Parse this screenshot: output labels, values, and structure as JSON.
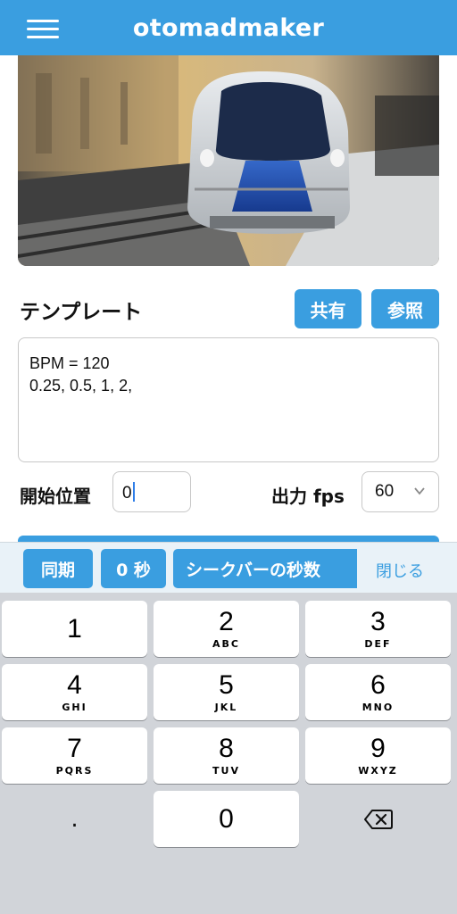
{
  "header": {
    "title": "otomadmaker"
  },
  "template_section": {
    "title": "テンプレート",
    "share_label": "共有",
    "reference_label": "参照",
    "text": "BPM = 120\n0.25, 0.5, 1, 2,"
  },
  "controls": {
    "start_position_label": "開始位置",
    "start_position_value": "0",
    "fps_label": "出力 fps",
    "fps_value": "60"
  },
  "accessory_bar": {
    "sync_label": "同期",
    "zero_sec_label": "0 秒",
    "seekbar_seconds_label": "シークバーの秒数",
    "close_label": "閉じる"
  },
  "keyboard": {
    "keys": [
      {
        "num": "1",
        "letters": ""
      },
      {
        "num": "2",
        "letters": "ABC"
      },
      {
        "num": "3",
        "letters": "DEF"
      },
      {
        "num": "4",
        "letters": "GHI"
      },
      {
        "num": "5",
        "letters": "JKL"
      },
      {
        "num": "6",
        "letters": "MNO"
      },
      {
        "num": "7",
        "letters": "PQRS"
      },
      {
        "num": "8",
        "letters": "TUV"
      },
      {
        "num": "9",
        "letters": "WXYZ"
      },
      {
        "num": "0",
        "letters": ""
      }
    ],
    "dot_key": ".",
    "icons": {
      "delete": "backspace-icon"
    }
  },
  "colors": {
    "accent": "#3a9ee0",
    "keyboard_bg": "#d1d4d9",
    "accessory_bg": "#e9f2f8"
  }
}
